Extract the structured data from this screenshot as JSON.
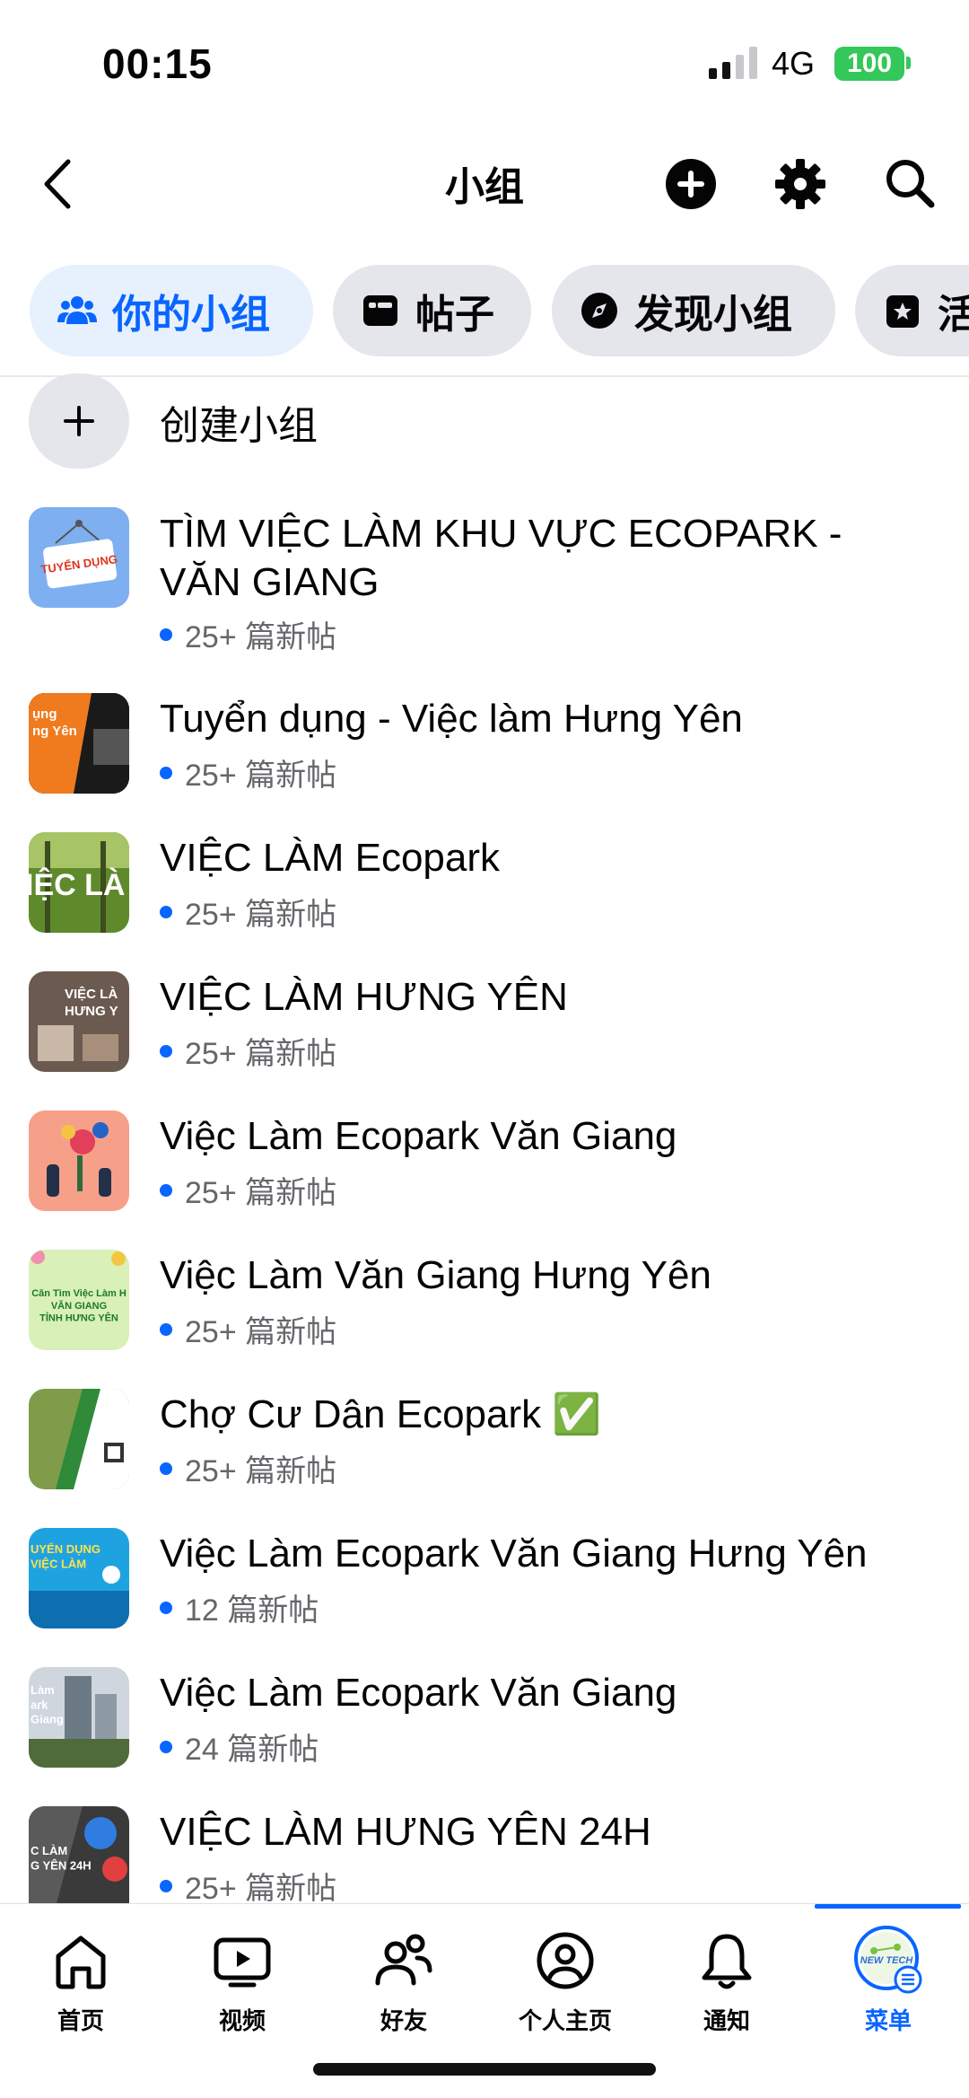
{
  "status_bar": {
    "time": "00:15",
    "network": "4G",
    "battery": "100"
  },
  "header": {
    "title": "小组"
  },
  "tabs": [
    {
      "label": "你的小组"
    },
    {
      "label": "帖子"
    },
    {
      "label": "发现小组"
    },
    {
      "label": "活"
    }
  ],
  "create_group": {
    "label": "创建小组"
  },
  "groups": [
    {
      "name": "TÌM VIỆC LÀM KHU VỰC ECOPARK - VĂN GIANG",
      "posts": "25+ 篇新帖"
    },
    {
      "name": "Tuyển dụng - Việc làm Hưng Yên",
      "posts": "25+ 篇新帖"
    },
    {
      "name": "VIỆC LÀM Ecopark",
      "posts": "25+ 篇新帖"
    },
    {
      "name": "VIỆC LÀM HƯNG YÊN",
      "posts": "25+ 篇新帖"
    },
    {
      "name": "Việc Làm Ecopark Văn Giang",
      "posts": "25+ 篇新帖"
    },
    {
      "name": "Việc Làm Văn Giang Hưng Yên",
      "posts": "25+ 篇新帖"
    },
    {
      "name": "Chợ Cư Dân Ecopark ✅",
      "posts": "25+ 篇新帖"
    },
    {
      "name": "Việc Làm Ecopark Văn Giang Hưng Yên",
      "posts": "12 篇新帖"
    },
    {
      "name": "Việc Làm Ecopark Văn Giang",
      "posts": "24 篇新帖"
    },
    {
      "name": "VIỆC LÀM HƯNG YÊN 24H",
      "posts": "25+ 篇新帖"
    }
  ],
  "thumb_text": {
    "t1": "TUYỂN DỤNG",
    "t2": "ụng\nng Yên",
    "t3": "IỆC LÀ",
    "t4": "VIỆC LÀ\nHƯNG Y",
    "t6": "Căn Tìm Việc Làm H\nVĂN GIANG\nTỈNH HƯNG YÊN",
    "t8": "UYỂN DỤNG\nVIỆC LÀM",
    "t9": "Làm\nark\nGiang",
    "t10": "C LÀM\nG YÊN 24H",
    "avatar": "NEW TECH"
  },
  "nav": [
    {
      "label": "首页"
    },
    {
      "label": "视频"
    },
    {
      "label": "好友"
    },
    {
      "label": "个人主页"
    },
    {
      "label": "通知"
    },
    {
      "label": "菜单"
    }
  ],
  "colors": {
    "accent": "#0866ff",
    "battery": "#34c759",
    "muted": "#65676b",
    "chip": "#e4e6eb"
  }
}
